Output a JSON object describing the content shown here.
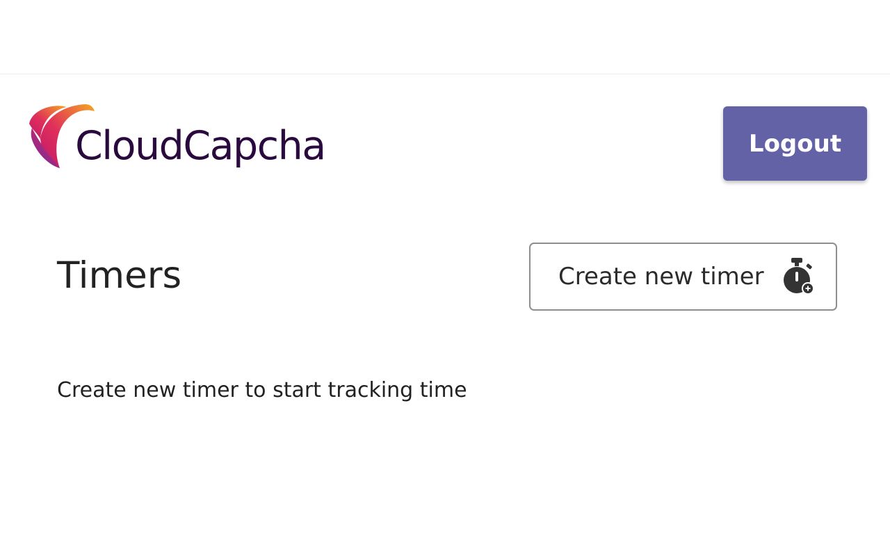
{
  "header": {
    "logo_text": "CloudCapcha",
    "logout_label": "Logout"
  },
  "main": {
    "title": "Timers",
    "create_button_label": "Create new timer",
    "empty_message": "Create new timer to start tracking time"
  },
  "icons": {
    "logo": "cloudcapcha-logo-icon",
    "create_timer": "stopwatch-add-icon"
  },
  "colors": {
    "logout_bg": "#6362a7",
    "logo_text": "#2a0a3e",
    "logo_gradient_start": "#c0186b",
    "logo_gradient_mid": "#7a2a9a",
    "logo_gradient_end": "#f5a623"
  }
}
